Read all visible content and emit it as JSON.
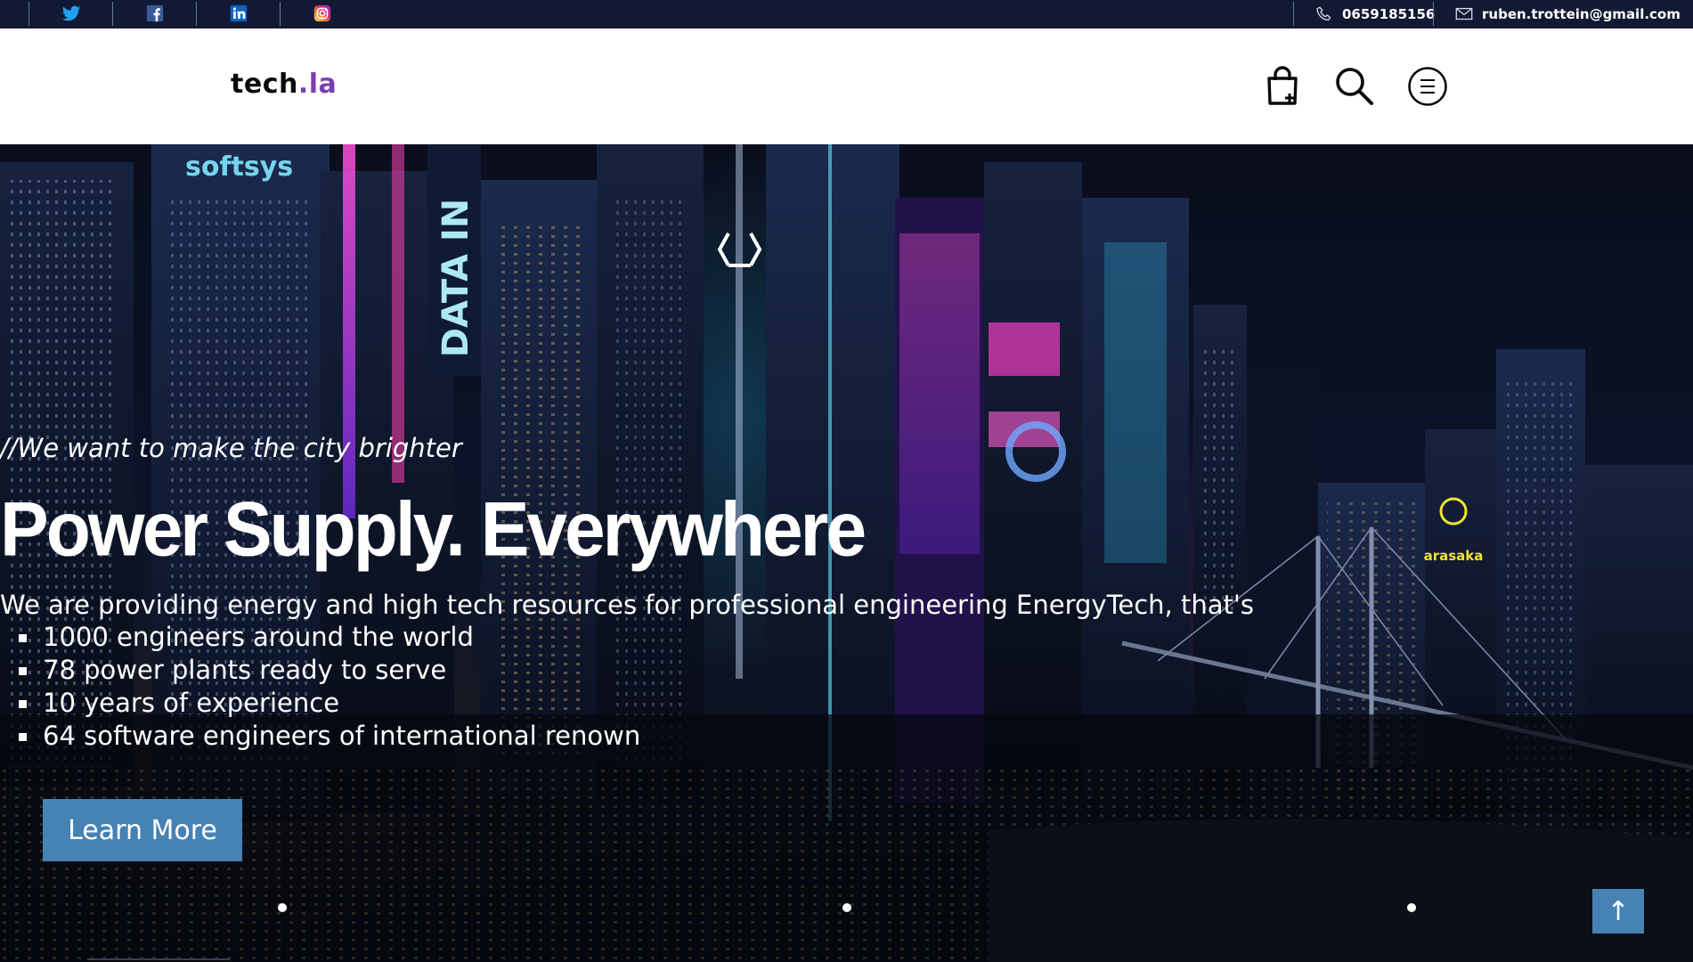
{
  "topbar": {
    "social": [
      {
        "name": "twitter-icon"
      },
      {
        "name": "facebook-icon"
      },
      {
        "name": "linkedin-icon"
      },
      {
        "name": "instagram-icon"
      }
    ],
    "phone": "0659185156",
    "email": "ruben.trottein@gmail.com"
  },
  "header": {
    "logo_main": "tech",
    "logo_dot": ".",
    "logo_accent": "la",
    "icons": [
      "shopping-bag-icon",
      "search-icon",
      "menu-icon"
    ]
  },
  "hero": {
    "tagline": "//We want to make the city brighter",
    "headline": "Power Supply. Everywhere",
    "description": "We are providing energy and high tech resources for professional engineering EnergyTech, that's",
    "features": [
      "1000 engineers around the world",
      "78 power plants ready to serve",
      "10 years of experience",
      "64 software engineers of international renown"
    ],
    "cta_label": "Learn More",
    "slides_count": 3,
    "scroll_top_label": "↑",
    "signage": [
      "softsys",
      "DATA IN",
      "arasaka"
    ]
  },
  "colors": {
    "topbar_bg": "#121a33",
    "accent_purple": "#7a3fb3",
    "button_blue": "#4682b4"
  }
}
